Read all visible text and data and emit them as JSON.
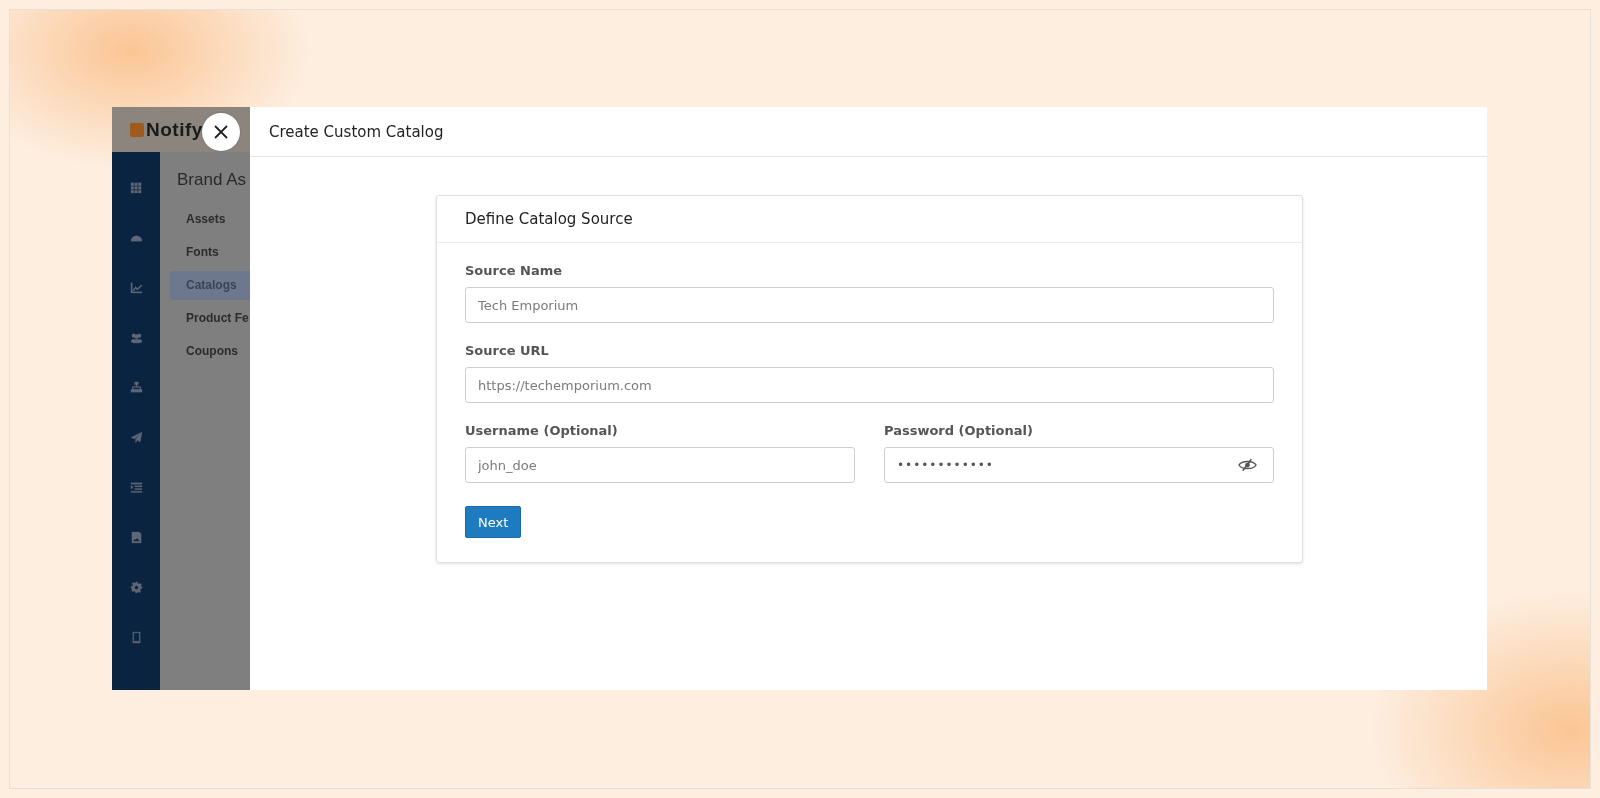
{
  "app": {
    "logo_text": "Notify"
  },
  "subnav": {
    "title": "Brand As",
    "items": [
      {
        "label": "Assets",
        "selected": false
      },
      {
        "label": "Fonts",
        "selected": false
      },
      {
        "label": "Catalogs",
        "selected": true
      },
      {
        "label": "Product Fe",
        "selected": false
      },
      {
        "label": "Coupons",
        "selected": false
      }
    ]
  },
  "modal": {
    "title": "Create Custom Catalog"
  },
  "card": {
    "title": "Define Catalog Source",
    "rows": [
      [
        {
          "kind": "text",
          "label": "Source Name",
          "placeholder": "Tech Emporium"
        }
      ],
      [
        {
          "kind": "text",
          "label": "Source URL",
          "placeholder": "https://techemporium.com"
        }
      ],
      [
        {
          "kind": "text",
          "label": "Username (Optional)",
          "placeholder": "john_doe"
        },
        {
          "kind": "password",
          "label": "Password (Optional)",
          "value": "••••••••••••"
        }
      ]
    ],
    "button": "Next"
  }
}
